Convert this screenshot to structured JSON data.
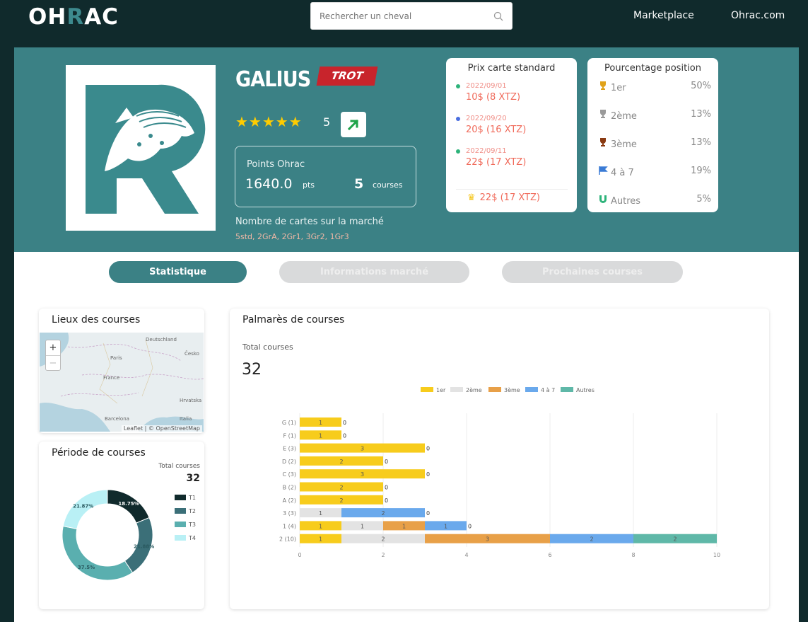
{
  "nav": {
    "logo_pre": "OH",
    "logo_r": "R",
    "logo_post": "AC",
    "search_placeholder": "Rechercher un cheval",
    "links": [
      "Marketplace",
      "Ohrac.com"
    ]
  },
  "horse": {
    "name": "GALIUS",
    "badge": "TROT",
    "stars": "★★★★★",
    "rating": "5",
    "points_label": "Points Ohrac",
    "points_value": "1640.0",
    "points_unit": "pts",
    "courses_value": "5",
    "courses_unit": "courses",
    "market_label": "Nombre de cartes sur la marché",
    "market_value": "5std, 2GrA, 2Gr1, 3Gr2, 1Gr3"
  },
  "price_card": {
    "title": "Prix carte standard",
    "entries": [
      {
        "date": "2022/09/01",
        "price": "10$ (8 XTZ)",
        "dot_color": "#2db37a"
      },
      {
        "date": "2022/09/20",
        "price": "20$ (16 XTZ)",
        "dot_color": "#4a6ee0"
      },
      {
        "date": "2022/09/11",
        "price": "22$ (17 XTZ)",
        "dot_color": "#2db37a"
      }
    ],
    "best": "22$ (17 XTZ)"
  },
  "pct_card": {
    "title": "Pourcentage position",
    "rows": [
      {
        "label": "1er",
        "value": "50%",
        "icon": "trophy-gold-icon",
        "color": "#e0a21a"
      },
      {
        "label": "2ème",
        "value": "13%",
        "icon": "trophy-silver-icon",
        "color": "#9a9a9a"
      },
      {
        "label": "3ème",
        "value": "13%",
        "icon": "trophy-bronze-icon",
        "color": "#8a3a12"
      },
      {
        "label": "4 à 7",
        "value": "19%",
        "icon": "flag-icon",
        "color": "#3a7bd5"
      },
      {
        "label": "Autres",
        "value": "5%",
        "icon": "magnet-icon",
        "color": "#2db37a"
      }
    ]
  },
  "tabs": [
    "Statistique",
    "Informations marché",
    "Prochaines courses"
  ],
  "map_panel": {
    "title": "Lieux des courses",
    "attribution": "Leaflet | © OpenStreetMap",
    "zoom_in": "+",
    "zoom_out": "−",
    "labels": [
      "Deutschland",
      "Paris",
      "France",
      "Česko",
      "Barcelona",
      "Italia",
      "Hrvatska"
    ]
  },
  "period_panel": {
    "title": "Période de courses",
    "total_label": "Total courses",
    "total_value": "32"
  },
  "palmares_panel": {
    "title": "Palmarès de courses",
    "total_label": "Total courses",
    "total_value": "32"
  },
  "colors": {
    "teal": "#3b8185",
    "dark": "#102a2c",
    "gold": "#f7cc1c",
    "grey": "#e3e3e3",
    "orange": "#e8a048",
    "blue": "#6aa9ec",
    "green": "#5fb8a8"
  },
  "chart_data": [
    {
      "type": "bar",
      "orientation": "horizontal",
      "stacked": true,
      "categories": [
        "G (1)",
        "F (1)",
        "E (3)",
        "D (2)",
        "C (3)",
        "B (2)",
        "A (2)",
        "3 (3)",
        "1 (4)",
        "2 (10)"
      ],
      "series": [
        {
          "name": "1er",
          "color": "#f7cc1c",
          "values": [
            1,
            1,
            3,
            2,
            3,
            2,
            2,
            0,
            1,
            1
          ]
        },
        {
          "name": "2ème",
          "color": "#e3e3e3",
          "values": [
            0,
            0,
            0,
            0,
            0,
            0,
            0,
            1,
            1,
            2
          ]
        },
        {
          "name": "3ème",
          "color": "#e8a048",
          "values": [
            0,
            0,
            0,
            0,
            0,
            0,
            0,
            0,
            1,
            3
          ]
        },
        {
          "name": "4 à 7",
          "color": "#6aa9ec",
          "values": [
            0,
            0,
            0,
            0,
            0,
            0,
            0,
            2,
            1,
            2
          ]
        },
        {
          "name": "Autres",
          "color": "#5fb8a8",
          "values": [
            0,
            0,
            0,
            0,
            0,
            0,
            0,
            0,
            0,
            2
          ]
        }
      ],
      "end_labels": [
        "0",
        "0",
        "0",
        "0",
        "0",
        "0",
        "0",
        "0",
        "0",
        ""
      ],
      "xlim": [
        0,
        10
      ],
      "xticks": [
        "0",
        "2",
        "4",
        "6",
        "8",
        "10"
      ],
      "legend": "top"
    },
    {
      "type": "pie",
      "donut": true,
      "categories": [
        "T1",
        "T2",
        "T3",
        "T4"
      ],
      "values": [
        18.75,
        21.88,
        37.5,
        21.87
      ],
      "labels": [
        "18.75%",
        "21.88%",
        "37.5%",
        "21.87%"
      ],
      "colors": [
        "#102a2c",
        "#3b6f78",
        "#5aafaf",
        "#b9f0f5"
      ],
      "legend": "right"
    }
  ]
}
